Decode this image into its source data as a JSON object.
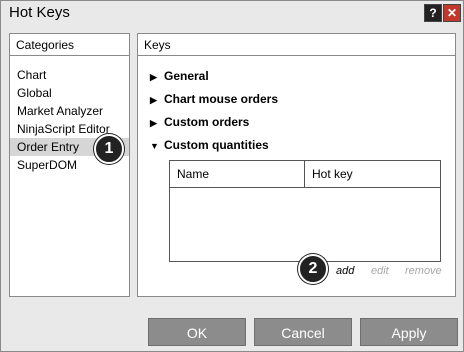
{
  "window": {
    "title": "Hot Keys",
    "help_glyph": "?",
    "close_glyph": "✕"
  },
  "categories": {
    "header": "Categories",
    "items": [
      "Chart",
      "Global",
      "Market Analyzer",
      "NinjaScript Editor",
      "Order Entry",
      "SuperDOM"
    ],
    "selected": "Order Entry"
  },
  "keys": {
    "header": "Keys",
    "sections": [
      {
        "label": "General",
        "expanded": false
      },
      {
        "label": "Chart mouse orders",
        "expanded": false
      },
      {
        "label": "Custom orders",
        "expanded": false
      },
      {
        "label": "Custom quantities",
        "expanded": true
      }
    ],
    "table": {
      "col_name": "Name",
      "col_hotkey": "Hot key"
    },
    "actions": {
      "add": "add",
      "edit": "edit",
      "remove": "remove"
    }
  },
  "badges": {
    "one": "1",
    "two": "2"
  },
  "buttons": {
    "ok": "OK",
    "cancel": "Cancel",
    "apply": "Apply"
  },
  "colors": {
    "button_bg": "#8c8c8c",
    "close_bg": "#c0392b",
    "selected_bg": "#d6d6d6"
  }
}
